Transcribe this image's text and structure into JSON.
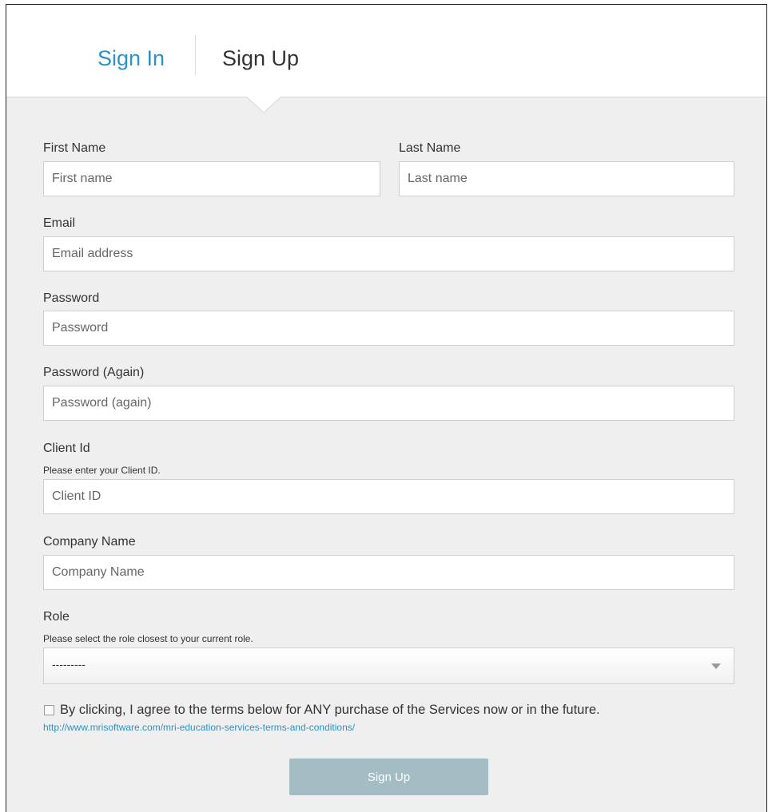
{
  "tabs": {
    "sign_in": "Sign In",
    "sign_up": "Sign Up"
  },
  "form": {
    "first_name": {
      "label": "First Name",
      "placeholder": "First name",
      "value": ""
    },
    "last_name": {
      "label": "Last Name",
      "placeholder": "Last name",
      "value": ""
    },
    "email": {
      "label": "Email",
      "placeholder": "Email address",
      "value": ""
    },
    "password": {
      "label": "Password",
      "placeholder": "Password",
      "value": ""
    },
    "password_again": {
      "label": "Password (Again)",
      "placeholder": "Password (again)",
      "value": ""
    },
    "client_id": {
      "label": "Client Id",
      "hint": "Please enter your Client ID.",
      "placeholder": "Client ID",
      "value": ""
    },
    "company_name": {
      "label": "Company Name",
      "placeholder": "Company Name",
      "value": ""
    },
    "role": {
      "label": "Role",
      "hint": "Please select the role closest to your current role.",
      "selected": "---------"
    },
    "agree": {
      "text": "By clicking, I agree to the terms below for ANY purchase of the Services now or in the future.",
      "link": "http://www.mrisoftware.com/mri-education-services-terms-and-conditions/",
      "checked": false
    },
    "submit_label": "Sign Up"
  },
  "colors": {
    "link": "#2a93c7",
    "button": "#a4bcc4",
    "panel": "#efefef"
  },
  "icons": {
    "role_dropdown": "caret-down-icon",
    "tab_pointer": "pointer-caret-icon"
  }
}
